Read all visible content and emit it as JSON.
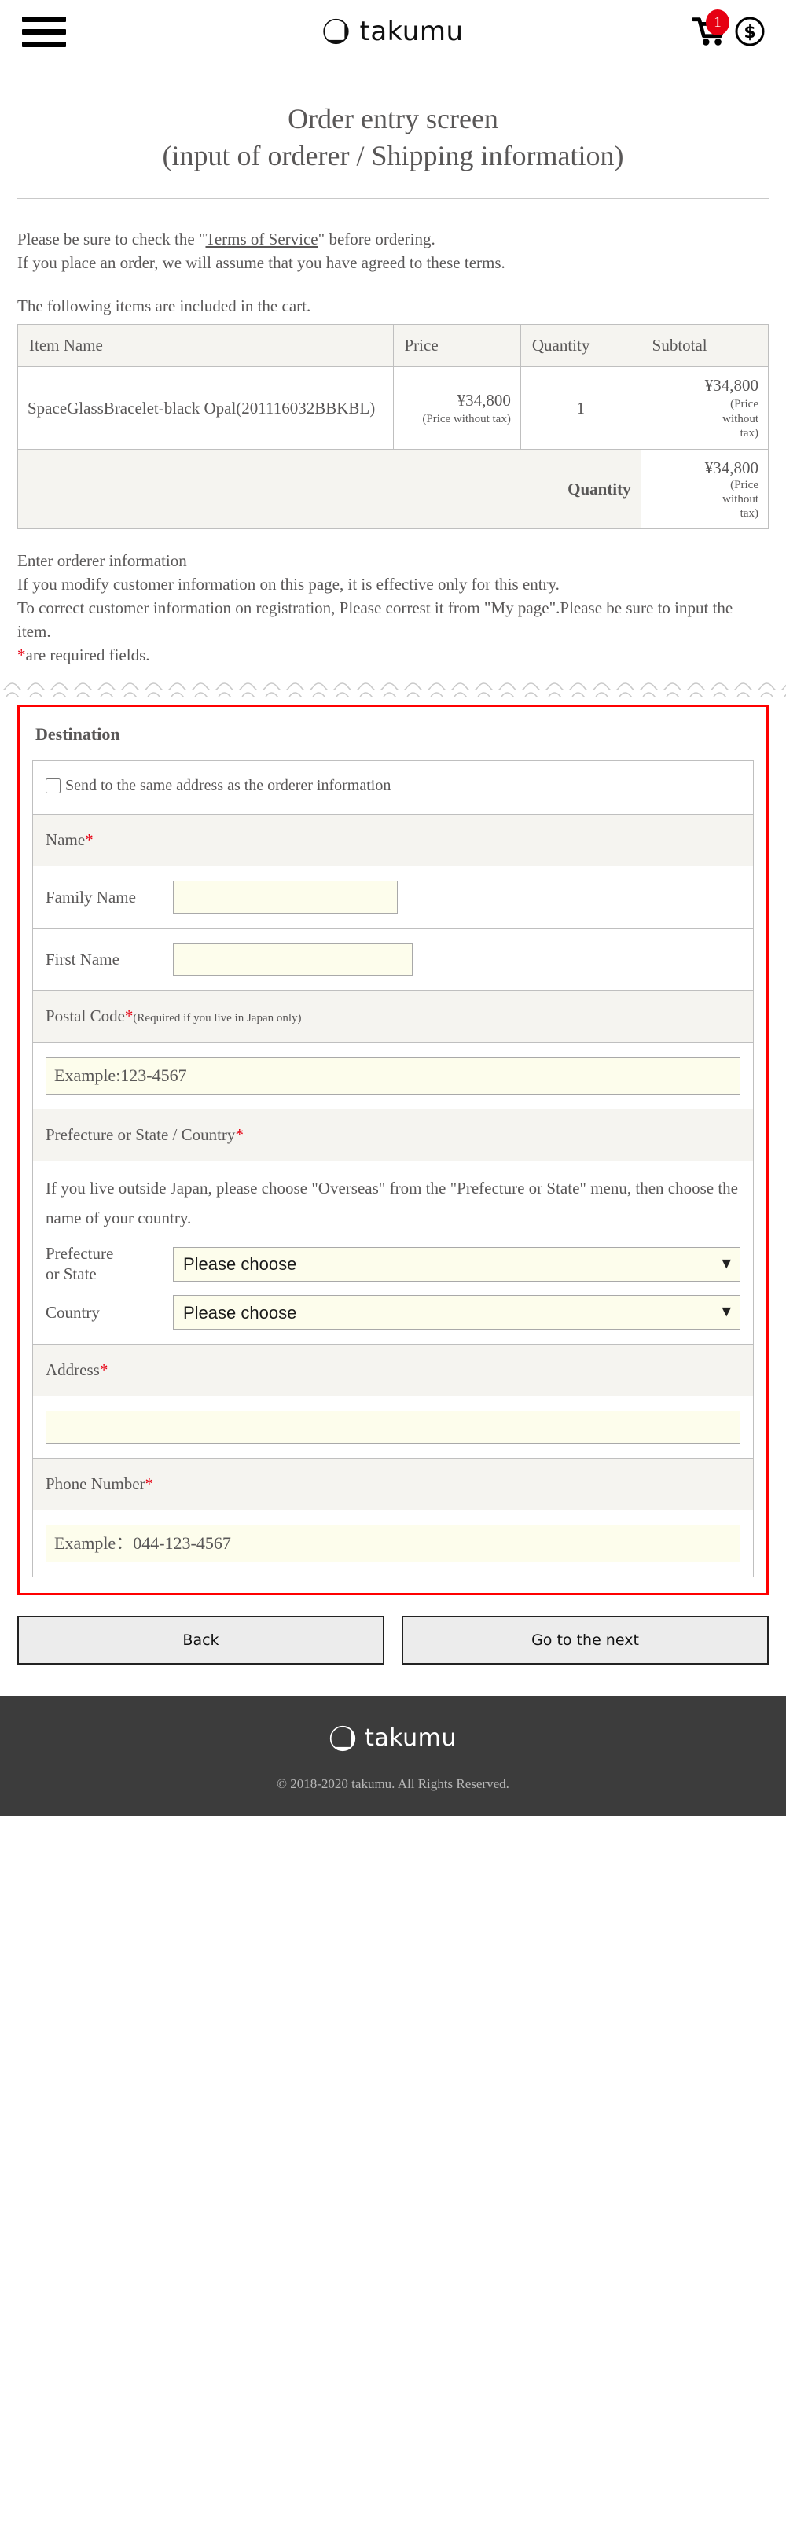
{
  "header": {
    "menu_label": "menu",
    "brand": "takumu",
    "cart_count": "1",
    "badge_color": "#e60012"
  },
  "page": {
    "title_line1": "Order entry screen",
    "title_line2": "(input of orderer / Shipping information)"
  },
  "intro": {
    "line1_before": "Please be sure to check the \"",
    "terms_link": "Terms of Service",
    "line1_after": "\" before ordering.",
    "line2": "If you place an order, we will assume that you have agreed to these terms.",
    "cart_lead": "The following items are included in the cart."
  },
  "cart_table": {
    "headers": [
      "Item Name",
      "Price",
      "Quantity",
      "Subtotal"
    ],
    "rows": [
      {
        "item_name": "SpaceGlassBracelet-black Opal(201116032BBKBL)",
        "price": "¥34,800",
        "price_note": "(Price without tax)",
        "quantity": "1",
        "subtotal": "¥34,800",
        "subtotal_note_line1": "(Price",
        "subtotal_note_line2": "without",
        "subtotal_note_line3": "tax)"
      }
    ],
    "total_label": "Quantity",
    "total_value": "¥34,800",
    "total_note_line1": "(Price",
    "total_note_line2": "without",
    "total_note_line3": "tax)"
  },
  "orderer": {
    "heading": "Enter orderer information",
    "line1": "If you modify customer information on this page, it is effective only for this entry.",
    "line2": "To correct customer information on registration, Please correst it from \"My page\".Please be sure to input the item.",
    "required_star": "*",
    "required_note": "are required fields."
  },
  "destination": {
    "title": "Destination",
    "same_address_label": "Send to the same address as the orderer information",
    "same_address_checked": false,
    "name_label": "Name",
    "family_name_label": "Family Name",
    "family_name_value": "",
    "first_name_label": "First Name",
    "first_name_value": "",
    "postal_label": "Postal Code",
    "postal_note": "(Required if you live in Japan only)",
    "postal_placeholder": "Example:123-4567",
    "postal_value": "",
    "prefecture_section_label": "Prefecture or State / Country",
    "overseas_note": "If you live outside Japan, please choose \"Overseas\" from the \"Prefecture or State\" menu, then choose the name of your country.",
    "prefecture_label_line1": "Prefecture",
    "prefecture_label_line2": "or State",
    "prefecture_selected": "Please choose",
    "country_label": "Country",
    "country_selected": "Please choose",
    "address_label": "Address",
    "address_value": "",
    "phone_label": "Phone Number",
    "phone_placeholder": "Example：044-123-4567",
    "phone_value": "",
    "border_color": "#ff0000"
  },
  "actions": {
    "back": "Back",
    "next": "Go to the next"
  },
  "footer": {
    "brand": "takumu",
    "copyright": "© 2018-2020 takumu. All Rights Reserved."
  }
}
